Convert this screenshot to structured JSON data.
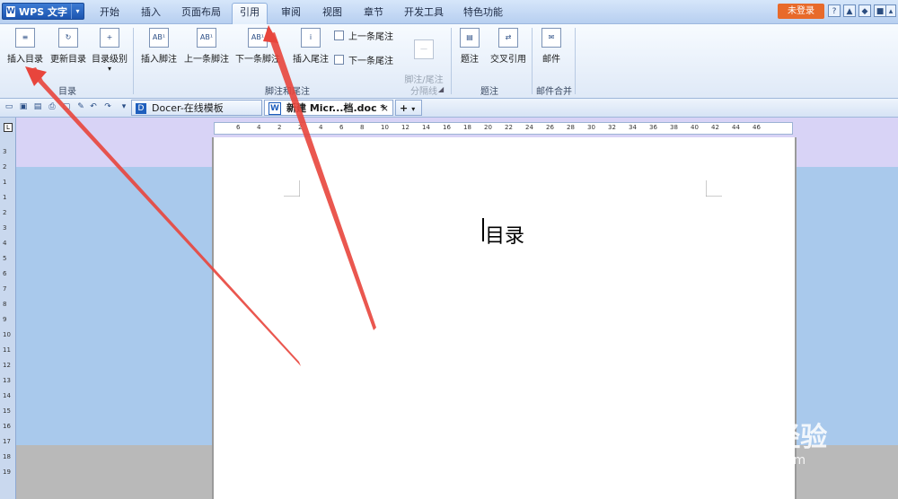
{
  "app": {
    "title": "WPS 文字",
    "login": "未登录"
  },
  "menu_tabs": [
    "开始",
    "插入",
    "页面布局",
    "引用",
    "审阅",
    "视图",
    "章节",
    "开发工具",
    "特色功能"
  ],
  "active_tab": "引用",
  "ribbon": {
    "insert_toc": "插入目录",
    "update_toc": "更新目录",
    "toc_level": "目录级别",
    "insert_footnote": "插入脚注",
    "prev_footnote": "上一条脚注",
    "next_footnote": "下一条脚注",
    "insert_endnote": "插入尾注",
    "prev_endnote": "上一条尾注",
    "next_endnote": "下一条尾注",
    "separator_line": "脚注/尾注\n分隔线",
    "caption": "题注",
    "cross_ref": "交叉引用",
    "mail": "邮件",
    "group_toc": "目录",
    "group_notes": "脚注和尾注",
    "group_caption": "题注",
    "group_mail": "邮件合并"
  },
  "doc_tabs": {
    "tab1": "Docer-在线模板",
    "tab2": "新建 Micr...档.doc *",
    "close": "×",
    "add": "+"
  },
  "ruler": {
    "h": [
      "6",
      "4",
      "2",
      "2",
      "4",
      "6",
      "8",
      "10",
      "12",
      "14",
      "16",
      "18",
      "20",
      "22",
      "24",
      "26",
      "28",
      "30",
      "32",
      "34",
      "36",
      "38",
      "40",
      "42",
      "44",
      "46"
    ],
    "v": [
      "3",
      "2",
      "1",
      "1",
      "2",
      "3",
      "4",
      "5",
      "6",
      "7",
      "8",
      "9",
      "10",
      "11",
      "12",
      "13",
      "14",
      "15",
      "16",
      "17",
      "18",
      "19"
    ],
    "corner": "L"
  },
  "document": {
    "heading": "目录"
  },
  "watermark": {
    "brand": "Baidu经验",
    "url": "jingyan.baidu.com"
  },
  "colors": {
    "login": "#e86a2a",
    "arrow": "#e8453c",
    "app_button": "#1c55b0"
  }
}
